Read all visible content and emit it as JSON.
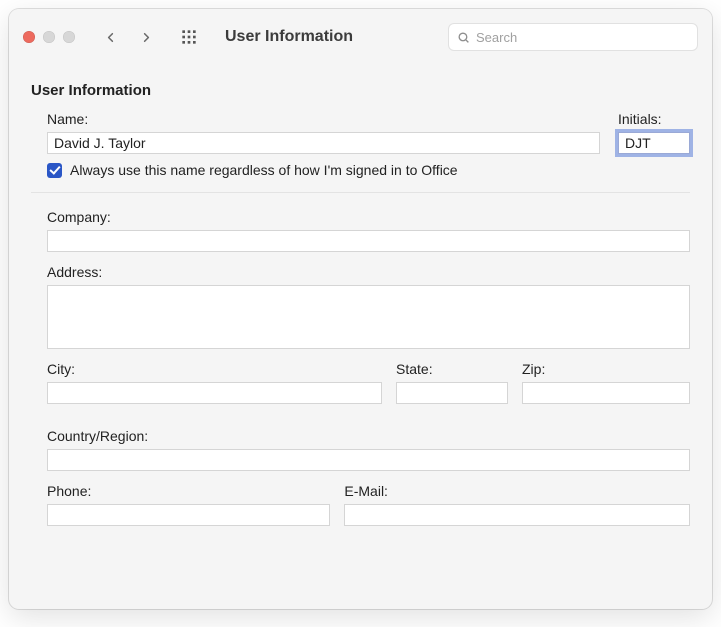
{
  "titlebar": {
    "title": "User Information",
    "search_placeholder": "Search"
  },
  "section": {
    "heading": "User Information",
    "name_label": "Name:",
    "name_value": "David J. Taylor",
    "initials_label": "Initials:",
    "initials_value": "DJT",
    "checkbox_label": "Always use this name regardless of how I'm signed in to Office",
    "checkbox_checked": true,
    "company_label": "Company:",
    "company_value": "",
    "address_label": "Address:",
    "address_value": "",
    "city_label": "City:",
    "city_value": "",
    "state_label": "State:",
    "state_value": "",
    "zip_label": "Zip:",
    "zip_value": "",
    "country_label": "Country/Region:",
    "country_value": "",
    "phone_label": "Phone:",
    "phone_value": "",
    "email_label": "E-Mail:",
    "email_value": ""
  }
}
